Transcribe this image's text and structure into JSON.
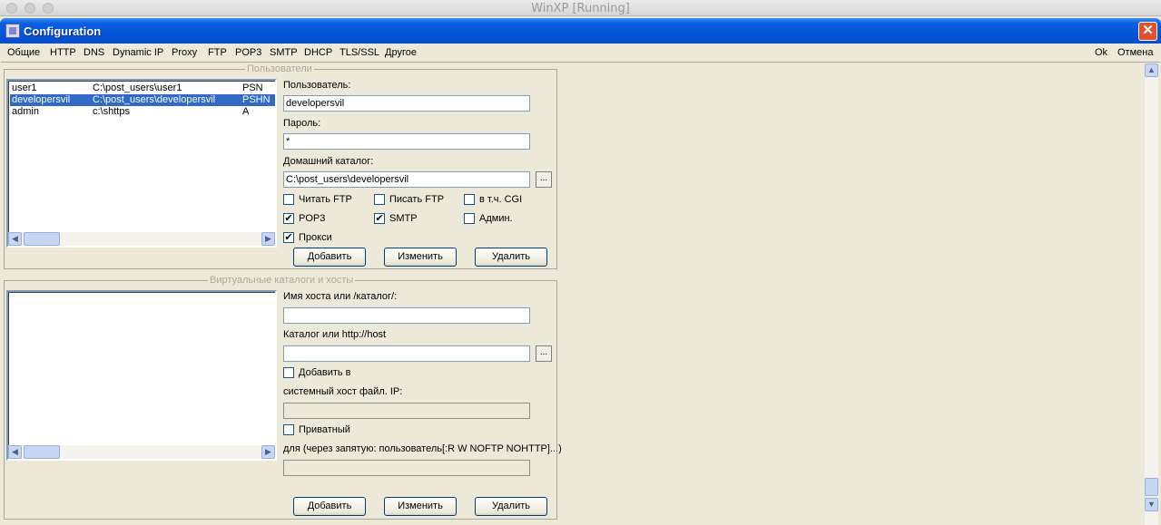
{
  "host": {
    "title": "WinXP [Running]"
  },
  "window": {
    "title": "Configuration",
    "close_glyph": "✕"
  },
  "menu": {
    "left": [
      "Общие",
      "HTTP",
      "DNS",
      "Dynamic IP",
      "Proxy",
      "FTP",
      "POP3",
      "SMTP",
      "DHCP",
      "TLS/SSL",
      "Другое"
    ],
    "ok": "Ok",
    "cancel": "Отмена"
  },
  "users": {
    "legend": "Пользователи",
    "rows": [
      {
        "name": "user1",
        "dir": "C:\\post_users\\user1",
        "flags": "PSN"
      },
      {
        "name": "developersvil",
        "dir": "C:\\post_users\\developersvil",
        "flags": "PSHN"
      },
      {
        "name": "admin",
        "dir": "c:\\shttps",
        "flags": "A"
      }
    ],
    "user_label": "Пользователь:",
    "user_value": "developersvil",
    "password_label": "Пароль:",
    "password_value": "*",
    "home_label": "Домашний каталог:",
    "home_value": "C:\\post_users\\developersvil",
    "browse": "...",
    "checkboxes": [
      {
        "label": "Читать FTP",
        "checked": false
      },
      {
        "label": "Писать FTP",
        "checked": false
      },
      {
        "label": "в т.ч. CGI",
        "checked": false
      },
      {
        "label": "POP3",
        "checked": true
      },
      {
        "label": "SMTP",
        "checked": true
      },
      {
        "label": "Админ.",
        "checked": false
      },
      {
        "label": "Прокси",
        "checked": true
      }
    ],
    "buttons": {
      "add": "Добавить",
      "edit": "Изменить",
      "delete": "Удалить"
    }
  },
  "virtual": {
    "legend": "Виртуальные каталоги и хосты",
    "host_label": "Имя хоста или /каталог/:",
    "host_value": "",
    "dir_label": "Каталог или http://host",
    "dir_value": "",
    "browse": "...",
    "add_to_label": "Добавить в",
    "add_to_checked": false,
    "hosts_label": "системный хост файл.  IP:",
    "ip_value": "",
    "private_label": "Приватный",
    "private_checked": false,
    "users_label": "для (через запятую: пользователь[:R W NOFTP NOHTTP]...)",
    "users_value": "",
    "buttons": {
      "add": "Добавить",
      "edit": "Изменить",
      "delete": "Удалить"
    }
  }
}
